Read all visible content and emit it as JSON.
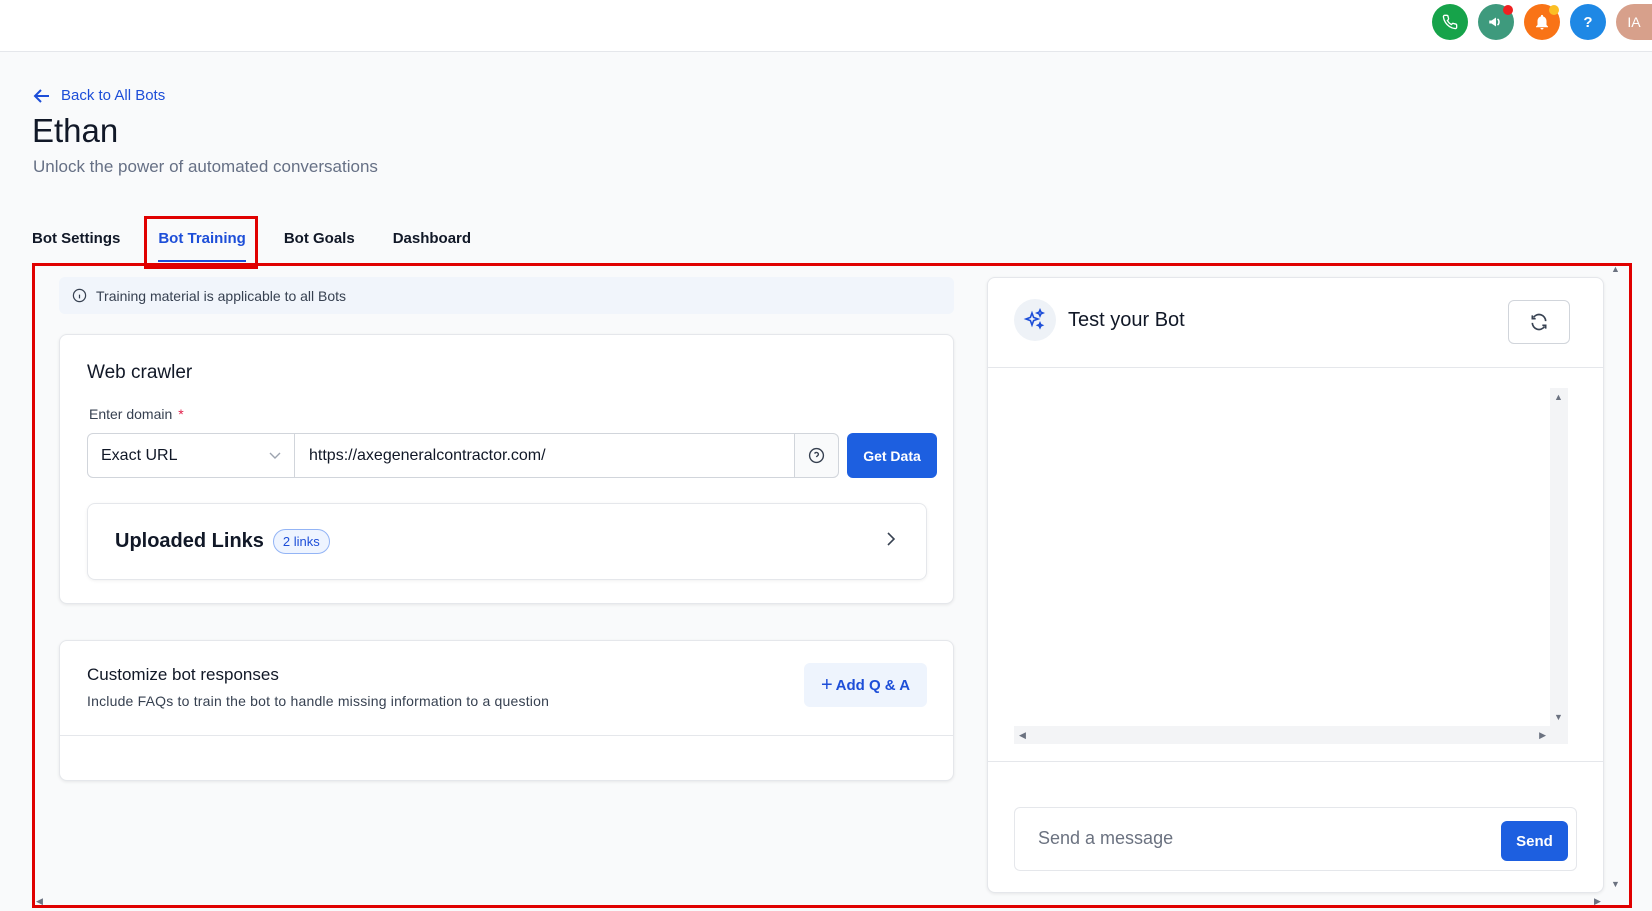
{
  "colors": {
    "accent": "#1d5fe0",
    "link": "#1d4ed8",
    "highlight": "#e00000",
    "phone_icon_bg": "#16a34a",
    "announce_icon_bg": "#3e9a7d",
    "notification_icon_bg": "#f97316",
    "help_icon_bg": "#1e88e5",
    "avatar_bg": "#d7a08b"
  },
  "topbar": {
    "icons": [
      "phone-icon",
      "megaphone-icon",
      "bell-icon",
      "help-icon"
    ],
    "help_label": "?",
    "avatar_initials": "IA"
  },
  "header": {
    "back_label": "Back to All Bots",
    "title": "Ethan",
    "subtitle": "Unlock the power of automated conversations"
  },
  "tabs": [
    {
      "label": "Bot Settings",
      "active": false
    },
    {
      "label": "Bot Training",
      "active": true
    },
    {
      "label": "Bot Goals",
      "active": false
    },
    {
      "label": "Dashboard",
      "active": false
    }
  ],
  "info_banner": {
    "text": "Training material is applicable to all Bots"
  },
  "web_crawler": {
    "title": "Web crawler",
    "domain_label": "Enter domain",
    "required_mark": "*",
    "mode_selected": "Exact URL",
    "url_value": "https://axegeneralcontractor.com/",
    "get_data_label": "Get Data",
    "uploaded_links": {
      "title": "Uploaded Links",
      "badge": "2 links"
    }
  },
  "faq": {
    "title": "Customize bot responses",
    "subtitle": "Include FAQs to train the bot to handle missing information to a question",
    "add_label": "Add Q & A",
    "add_prefix": "+"
  },
  "test_bot": {
    "title": "Test your Bot",
    "message_placeholder": "Send a message",
    "send_label": "Send"
  }
}
